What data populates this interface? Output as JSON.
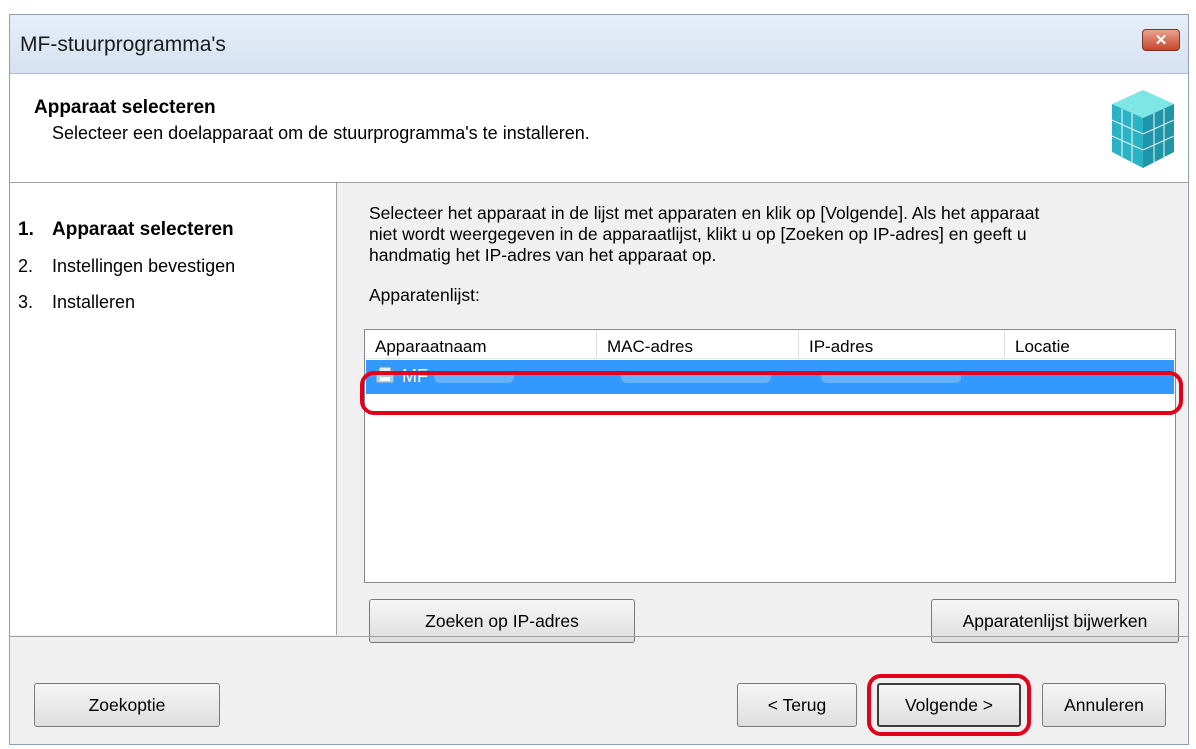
{
  "window": {
    "title": "MF-stuurprogramma's",
    "close_label": "✕"
  },
  "header": {
    "title": "Apparaat selecteren",
    "subtitle": "Selecteer een doelapparaat om de stuurprogramma's te installeren.",
    "icon": "cube-icon"
  },
  "steps": [
    {
      "num": "1.",
      "label": "Apparaat selecteren",
      "active": true
    },
    {
      "num": "2.",
      "label": "Instellingen bevestigen",
      "active": false
    },
    {
      "num": "3.",
      "label": "Installeren",
      "active": false
    }
  ],
  "content": {
    "description_lines": [
      "Selecteer het apparaat in de lijst met apparaten en klik op [Volgende].  Als het apparaat",
      "niet wordt weergegeven in de apparaatlijst, klikt u op [Zoeken op IP-adres] en geeft u",
      "handmatig het IP-adres van het apparaat op."
    ],
    "list_label": "Apparatenlijst:",
    "columns": [
      "Apparaatnaam",
      "MAC-adres",
      "IP-adres",
      "Locatie"
    ],
    "rows": [
      {
        "name": "MF",
        "icon": "printer-icon",
        "selected": true
      }
    ],
    "search_ip_button": "Zoeken op IP-adres",
    "refresh_button": "Apparatenlijst bijwerken"
  },
  "footer": {
    "options_button": "Zoekoptie",
    "back_button": "< Terug",
    "next_button": "Volgende >",
    "cancel_button": "Annuleren"
  },
  "colors": {
    "highlight": "#e2001a",
    "selection": "#3399ff"
  }
}
